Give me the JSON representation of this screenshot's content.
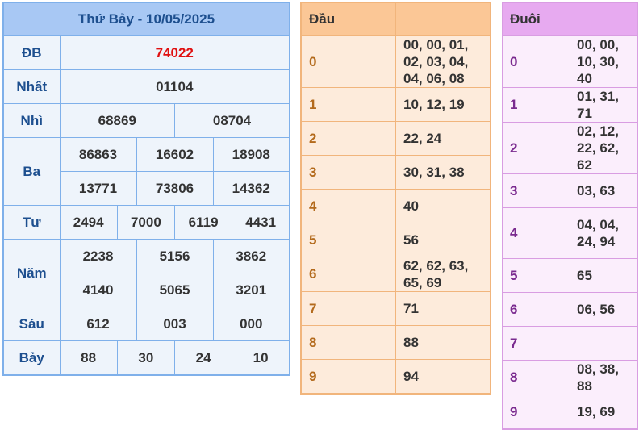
{
  "results": {
    "title": "Thứ Bảy - 10/05/2025",
    "special": {
      "label": "ĐB",
      "value": "74022"
    },
    "first": {
      "label": "Nhất",
      "value": "01104"
    },
    "second": {
      "label": "Nhì",
      "values": [
        "68869",
        "08704"
      ]
    },
    "third": {
      "label": "Ba",
      "values": [
        "86863",
        "16602",
        "18908",
        "13771",
        "73806",
        "14362"
      ]
    },
    "fourth": {
      "label": "Tư",
      "values": [
        "2494",
        "7000",
        "6119",
        "4431"
      ]
    },
    "fifth": {
      "label": "Năm",
      "values": [
        "2238",
        "5156",
        "3862",
        "4140",
        "5065",
        "3201"
      ]
    },
    "sixth": {
      "label": "Sáu",
      "values": [
        "612",
        "003",
        "000"
      ]
    },
    "seventh": {
      "label": "Bảy",
      "values": [
        "88",
        "30",
        "24",
        "10"
      ]
    }
  },
  "dau": {
    "header": "Đầu",
    "rows": [
      {
        "digit": "0",
        "values": "00, 00, 01, 02, 03, 04, 04, 06, 08"
      },
      {
        "digit": "1",
        "values": "10, 12, 19"
      },
      {
        "digit": "2",
        "values": "22, 24"
      },
      {
        "digit": "3",
        "values": "30, 31, 38"
      },
      {
        "digit": "4",
        "values": "40"
      },
      {
        "digit": "5",
        "values": "56"
      },
      {
        "digit": "6",
        "values": "62, 62, 63, 65, 69"
      },
      {
        "digit": "7",
        "values": "71"
      },
      {
        "digit": "8",
        "values": "88"
      },
      {
        "digit": "9",
        "values": "94"
      }
    ]
  },
  "duoi": {
    "header": "Đuôi",
    "rows": [
      {
        "digit": "0",
        "values": "00, 00, 10, 30, 40"
      },
      {
        "digit": "1",
        "values": "01, 31, 71"
      },
      {
        "digit": "2",
        "values": "02, 12, 22, 62, 62"
      },
      {
        "digit": "3",
        "values": "03, 63"
      },
      {
        "digit": "4",
        "values": "04, 04, 24, 94"
      },
      {
        "digit": "5",
        "values": "65"
      },
      {
        "digit": "6",
        "values": "06, 56"
      },
      {
        "digit": "7",
        "values": ""
      },
      {
        "digit": "8",
        "values": "08, 38, 88"
      },
      {
        "digit": "9",
        "values": "19, 69"
      }
    ]
  },
  "colors": {
    "results_header": "#a8c8f4",
    "results_border": "#7fb0ea",
    "special_value": "#e01010",
    "dau_header": "#fbc796",
    "dau_border": "#f1b57c",
    "duoi_header": "#e7aaf0",
    "duoi_border": "#d99de2"
  }
}
